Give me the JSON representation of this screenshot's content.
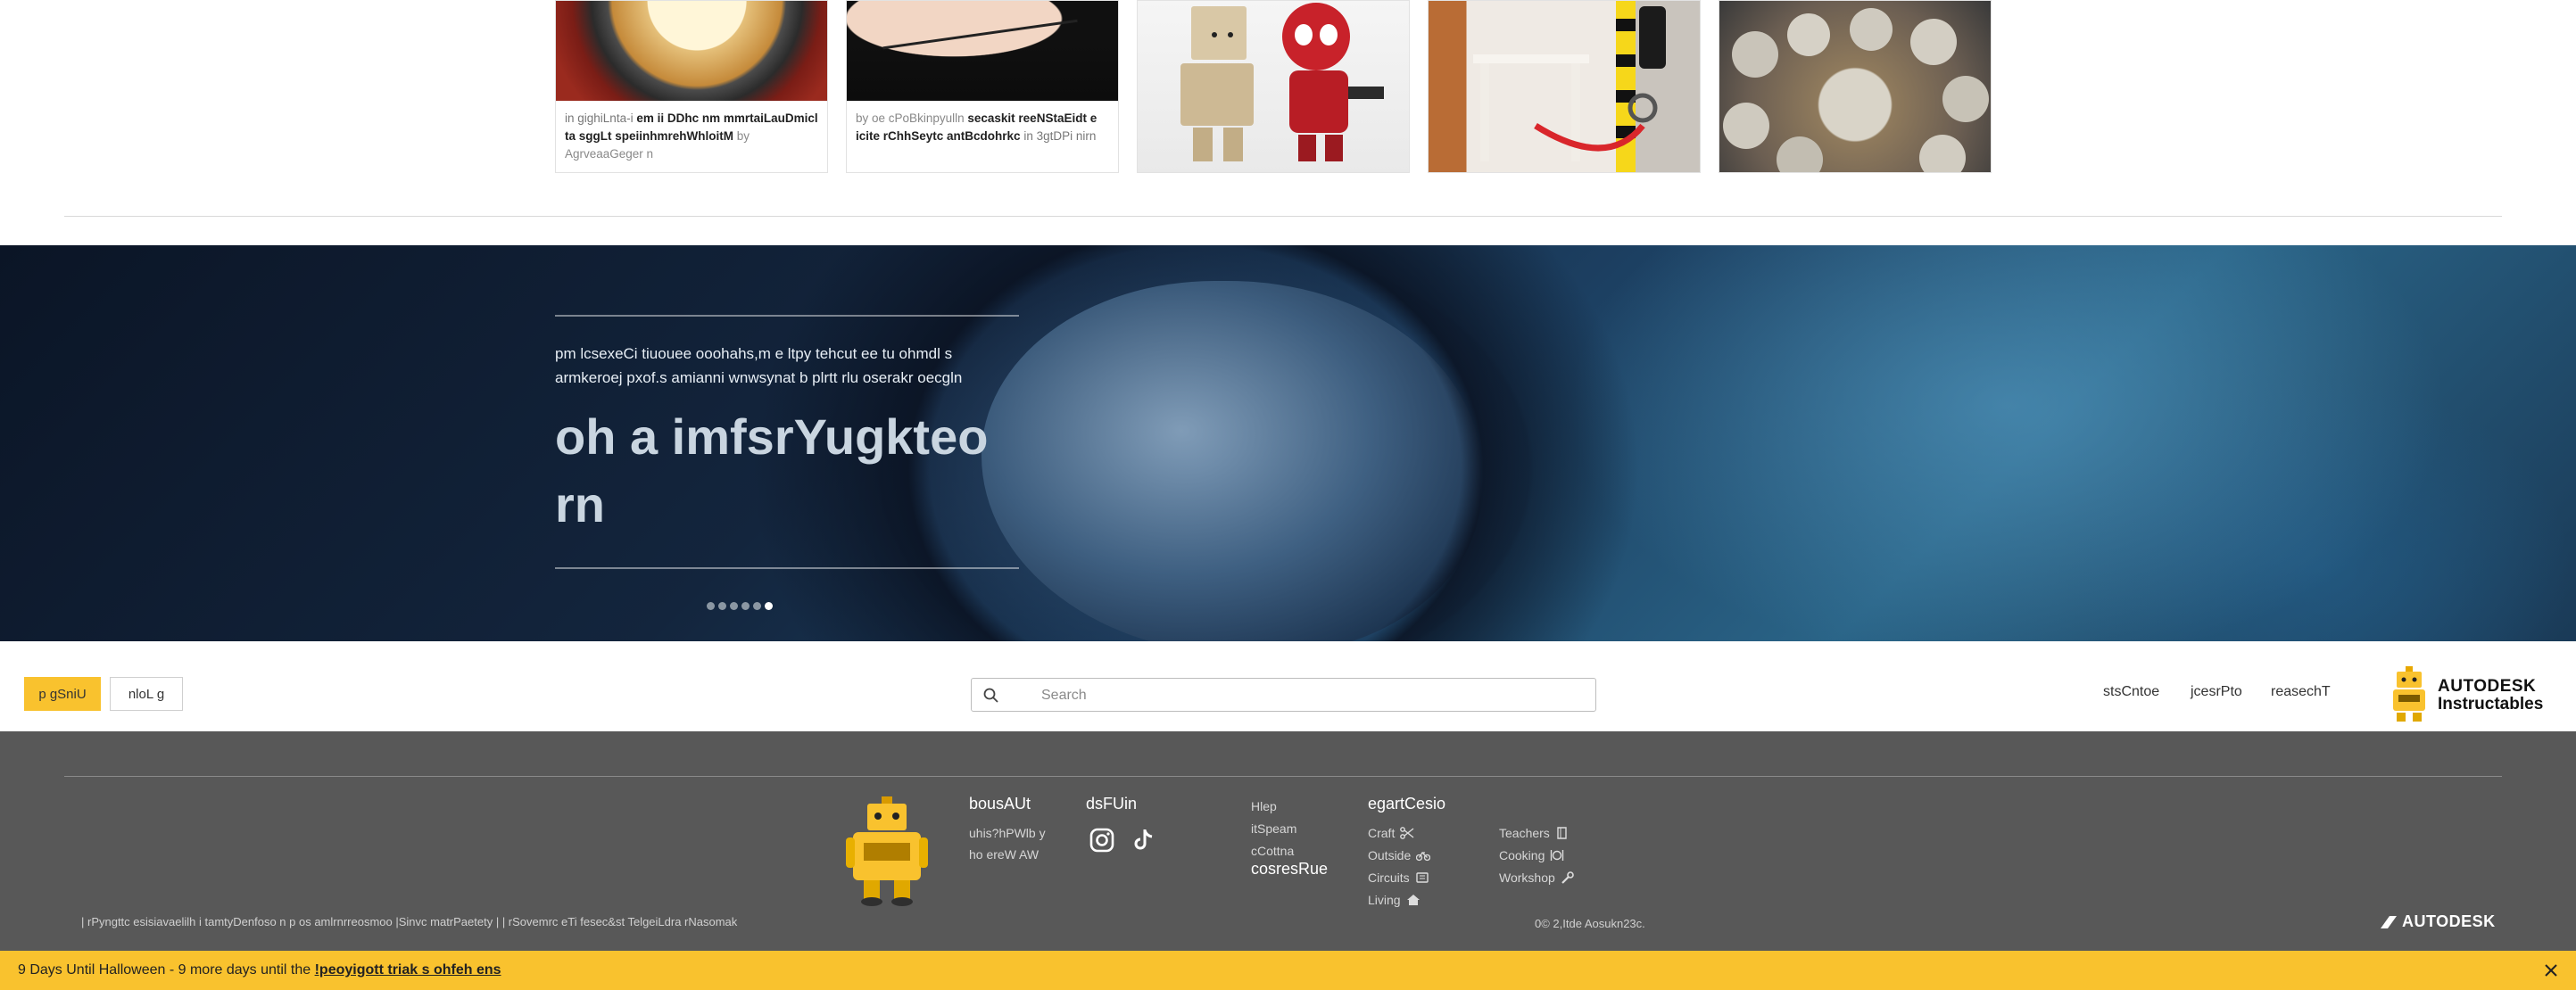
{
  "cards": [
    {
      "prefix": "in",
      "category": "gighiLnta-i",
      "title": "em ii DDhc nm mmrtaiLauDmicl ta sggLt speiinhmrehWhloitM",
      "by_word": "by",
      "author": "AgrveaaGeger n"
    },
    {
      "by_word": "by",
      "author": "oe cPoBkinpyulln",
      "title": "secaskit reeNStaEidt e icite rChhSeytc antBcdohrkc",
      "in_word": "in",
      "category": "3gtDPi nirn"
    },
    {},
    {},
    {}
  ],
  "hero": {
    "description": "pm lcsexeCi tiuouee ooohahs,m e ltpy tehcut ee tu ohmdl s armkeroej pxof.s amianni wnwsynat b plrtt rlu oserakr oecgln",
    "title": "oh a imfsrYugkteo rn",
    "slides": [
      0,
      1,
      2,
      3,
      4,
      5
    ],
    "active_slide": 5
  },
  "toolbar": {
    "signup_label": "p gSniU",
    "login_label": "nloL g",
    "search_placeholder": "Search",
    "links": [
      "stsCntoe",
      "jcesrPto",
      "reasechT"
    ],
    "brand_line1": "AUTODESK",
    "brand_line2": "Instructables"
  },
  "footer": {
    "about": {
      "heading": "bousAUt",
      "lines": [
        "uhis?hPWlb y",
        "ho ereW AW"
      ]
    },
    "find": {
      "heading": "dsFUin"
    },
    "resources": {
      "links": [
        "Hlep",
        "itSpeam",
        "cCottna"
      ],
      "heading": "cosresRue"
    },
    "categories": {
      "heading": "egartCesio",
      "left": [
        {
          "label": "Craft",
          "icon": "scissors-icon"
        },
        {
          "label": "Outside",
          "icon": "bicycle-icon"
        },
        {
          "label": "Circuits",
          "icon": "chip-icon"
        },
        {
          "label": "Living",
          "icon": "home-icon"
        }
      ],
      "right": [
        {
          "label": "Teachers",
          "icon": "book-icon"
        },
        {
          "label": "Cooking",
          "icon": "cutlery-icon"
        },
        {
          "label": "Workshop",
          "icon": "wrench-icon"
        }
      ]
    },
    "legal": "| rPyngttc esisiavaelilh i tamtyDenfoso n p os amlrnrreosmoo |Sinvc matrPaetety |  | rSovemrc eTi fesec&st TelgeiLdra rNasomak",
    "copyright": "0© 2,Itde Aosukn23c.",
    "brand": "AUTODESK"
  },
  "banner": {
    "text": "9 Days Until Halloween - 9 more days until the ",
    "link": "!peoyigott triak s ohfeh ens"
  },
  "colors": {
    "accent": "#f9c22e",
    "footer_bg": "#585858"
  }
}
